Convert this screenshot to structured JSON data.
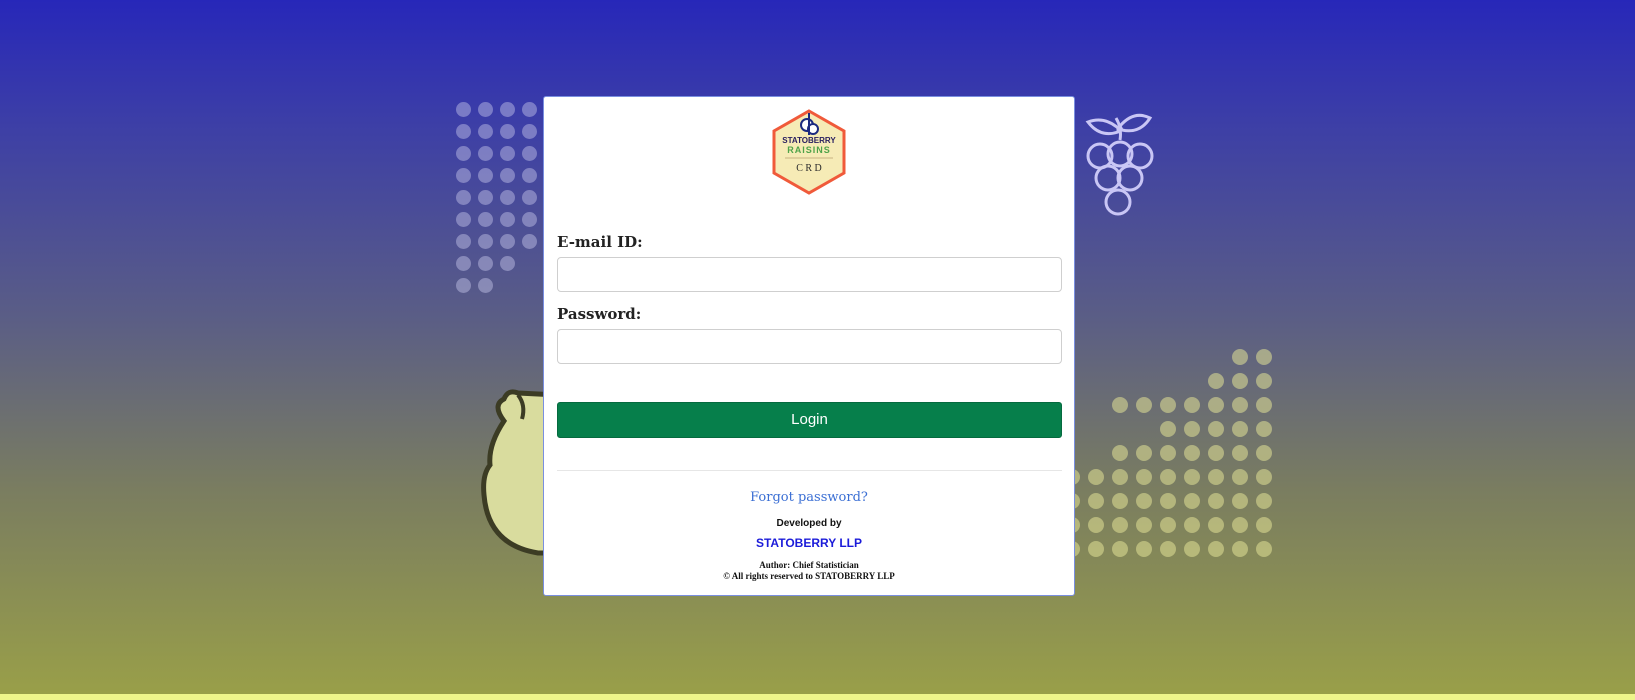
{
  "logo": {
    "brand_top": "STATOBERRY",
    "brand_middle": "RAISINS",
    "brand_bottom": "C R D"
  },
  "form": {
    "email_label": "E-mail ID:",
    "email_value": "",
    "email_placeholder": "",
    "password_label": "Password:",
    "password_value": "",
    "password_placeholder": "",
    "login_label": "Login"
  },
  "footer": {
    "forgot_password": "Forgot password?",
    "developed_by": "Developed by",
    "company": "STATOBERRY LLP",
    "author": "Author: Chief Statistician",
    "rights": "© All rights reserved to STATOBERRY LLP"
  },
  "colors": {
    "login_button": "#067f4b",
    "link": "#3b6fd4",
    "company_link": "#1b1bd9",
    "background_top": "#2727b9",
    "background_bottom": "#9aa048"
  },
  "decorations": {
    "top_right_icon": "grapes-icon",
    "left_icon": "pear-icon"
  }
}
